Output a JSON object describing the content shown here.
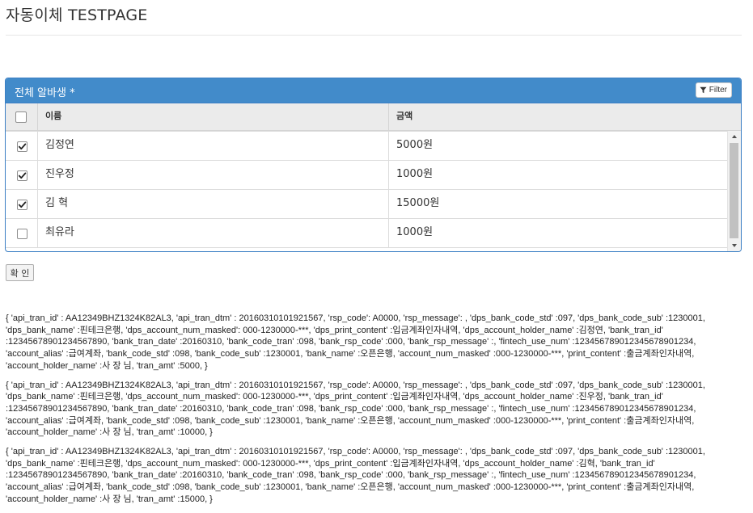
{
  "page": {
    "title": "자동이체 TESTPAGE"
  },
  "panel": {
    "title": "전체 알바생 *",
    "filter_label": "Filter"
  },
  "grid": {
    "columns": {
      "name": "이름",
      "amount": "금액"
    },
    "rows": [
      {
        "name": "김정연",
        "amount": "5000원",
        "checked": true
      },
      {
        "name": "진우정",
        "amount": "1000원",
        "checked": true
      },
      {
        "name": "김 혁",
        "amount": "15000원",
        "checked": true
      },
      {
        "name": "최유라",
        "amount": "1000원",
        "checked": false
      }
    ]
  },
  "confirm_label": "확 인",
  "log_entries": [
    "{ 'api_tran_id' : AA12349BHZ1324K82AL3, 'api_tran_dtm' : 20160310101921567, 'rsp_code': A0000, 'rsp_message': , 'dps_bank_code_std' :097, 'dps_bank_code_sub' :1230001, 'dps_bank_name' :핀테크은행, 'dps_account_num_masked': 000-1230000-***, 'dps_print_content' :입금계좌인자내역, 'dps_account_holder_name' :김정연, 'bank_tran_id' :12345678901234567890, 'bank_tran_date' :20160310, 'bank_code_tran' :098, 'bank_rsp_code' :000, 'bank_rsp_message' :, 'fintech_use_num' :123456789012345678901234, 'account_alias' :급여계좌, 'bank_code_std' :098, 'bank_code_sub' :1230001, 'bank_name' :오픈은행, 'account_num_masked' :000-1230000-***, 'print_content' :출금계좌인자내역, 'account_holder_name' :사 장 님, 'tran_amt' :5000, }",
    "{ 'api_tran_id' : AA12349BHZ1324K82AL3, 'api_tran_dtm' : 20160310101921567, 'rsp_code': A0000, 'rsp_message': , 'dps_bank_code_std' :097, 'dps_bank_code_sub' :1230001, 'dps_bank_name' :핀테크은행, 'dps_account_num_masked': 000-1230000-***, 'dps_print_content' :입금계좌인자내역, 'dps_account_holder_name' :진우정, 'bank_tran_id' :12345678901234567890, 'bank_tran_date' :20160310, 'bank_code_tran' :098, 'bank_rsp_code' :000, 'bank_rsp_message' :, 'fintech_use_num' :123456789012345678901234, 'account_alias' :급여계좌, 'bank_code_std' :098, 'bank_code_sub' :1230001, 'bank_name' :오픈은행, 'account_num_masked' :000-1230000-***, 'print_content' :출금계좌인자내역, 'account_holder_name' :사 장 님, 'tran_amt' :10000, }",
    "{ 'api_tran_id' : AA12349BHZ1324K82AL3, 'api_tran_dtm' : 20160310101921567, 'rsp_code': A0000, 'rsp_message': , 'dps_bank_code_std' :097, 'dps_bank_code_sub' :1230001, 'dps_bank_name' :핀테크은행, 'dps_account_num_masked': 000-1230000-***, 'dps_print_content' :입금계좌인자내역, 'dps_account_holder_name' :김혁, 'bank_tran_id' :12345678901234567890, 'bank_tran_date' :20160310, 'bank_code_tran' :098, 'bank_rsp_code' :000, 'bank_rsp_message' :, 'fintech_use_num' :123456789012345678901234, 'account_alias' :급여계좌, 'bank_code_std' :098, 'bank_code_sub' :1230001, 'bank_name' :오픈은행, 'account_num_masked' :000-1230000-***, 'print_content' :출금계좌인자내역, 'account_holder_name' :사 장 님, 'tran_amt' :15000, }"
  ]
}
